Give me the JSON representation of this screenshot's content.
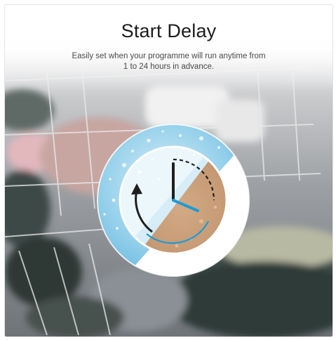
{
  "heading": {
    "title": "Start Delay",
    "subtitle_line1": "Easily set when your programme will run anytime from",
    "subtitle_line2": "1 to 24 hours in advance."
  },
  "icons": {
    "badge": "clock-icon",
    "arrow": "counterclockwise-arrow-icon"
  },
  "colors": {
    "accent_blue": "#1e9ad6",
    "water_blue": "#8fcdea",
    "coffee_brown": "#c79a72",
    "title_text": "#1c1c1c",
    "badge_ring": "#ffffff"
  }
}
